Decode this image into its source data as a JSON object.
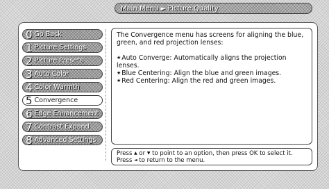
{
  "breadcrumb": {
    "root": "Main Menu",
    "separator": "►",
    "current": "Picture Quality"
  },
  "menu": [
    {
      "number": "0",
      "label": "Go Back"
    },
    {
      "number": "1",
      "label": "Picture Settings"
    },
    {
      "number": "2",
      "label": "Picture Presets"
    },
    {
      "number": "3",
      "label": "Auto Color"
    },
    {
      "number": "4",
      "label": "Color Warmth"
    },
    {
      "number": "5",
      "label": "Convergence"
    },
    {
      "number": "6",
      "label": "Edge Enhancement"
    },
    {
      "number": "7",
      "label": "Contrast Expand"
    },
    {
      "number": "8",
      "label": "Advanced Settings"
    }
  ],
  "selected_item": "Convergence",
  "content": {
    "intro": "The Convergence menu has screens for aligning the blue, green, and red projection lenses:",
    "bullet_marker": "★",
    "bullets": [
      "Auto Converge: Automatically aligns the projection lenses.",
      "Blue Centering: Align the blue and green images.",
      "Red Centering: Align the red and green images."
    ]
  },
  "help": {
    "part1": "Press ",
    "up_arrow": "▲",
    "part2": " or ",
    "down_arrow": "▼",
    "part3": " to point to an option, then press OK to select it. Press ",
    "left_arrow": "◄",
    "part4": " to return to the menu."
  }
}
